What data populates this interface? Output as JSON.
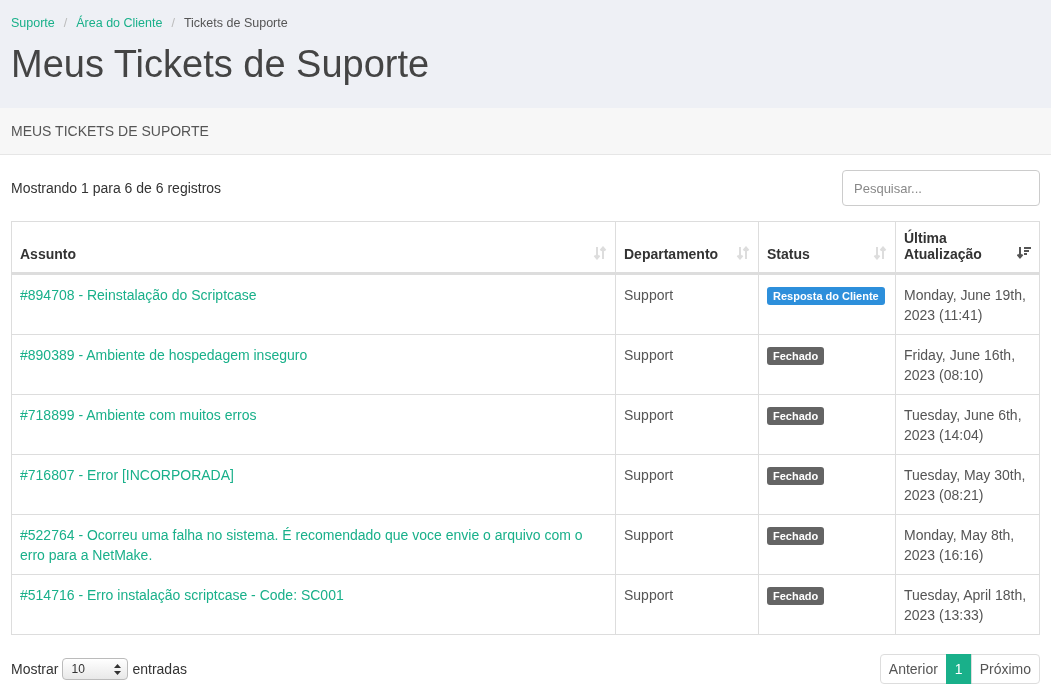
{
  "breadcrumb": [
    {
      "label": "Suporte",
      "current": false
    },
    {
      "separator": "/",
      "label": "Área do Cliente",
      "current": false
    },
    {
      "separator": "/",
      "label": "Tickets de Suporte",
      "current": true
    }
  ],
  "page_title": "Meus Tickets de Suporte",
  "panel_title": "MEUS TICKETS DE SUPORTE",
  "info": "Mostrando 1 para 6 de 6 registros",
  "search": {
    "placeholder": "Pesquisar..."
  },
  "columns": [
    {
      "label": "Assunto",
      "sorted": false
    },
    {
      "label": "Departamento",
      "sorted": false
    },
    {
      "label": "Status",
      "sorted": false
    },
    {
      "label": "Última Atualização",
      "sorted": true
    }
  ],
  "rows": [
    {
      "subject": "#894708 - Reinstalação do Scriptcase",
      "department": "Support",
      "status": "Resposta do Cliente",
      "color": "#2d8fdb",
      "updated": "Monday, June 19th, 2023 (11:41)"
    },
    {
      "subject": "#890389 - Ambiente de hospedagem inseguro",
      "department": "Support",
      "status": "Fechado",
      "color": "#646464",
      "updated": "Friday, June 16th, 2023 (08:10)"
    },
    {
      "subject": "#718899 - Ambiente com muitos erros",
      "department": "Support",
      "status": "Fechado",
      "color": "#646464",
      "updated": "Tuesday, June 6th, 2023 (14:04)"
    },
    {
      "subject": "#716807 - Error [INCORPORADA]",
      "department": "Support",
      "status": "Fechado",
      "color": "#646464",
      "updated": "Tuesday, May 30th, 2023 (08:21)"
    },
    {
      "subject": "#522764 - Ocorreu uma falha no sistema. É recomendado que voce envie o arquivo com o erro para a NetMake.",
      "department": "Support",
      "status": "Fechado",
      "color": "#646464",
      "updated": "Monday, May 8th, 2023 (16:16)"
    },
    {
      "subject": "#514716 - Erro instalação scriptcase - Code: SC001",
      "department": "Support",
      "status": "Fechado",
      "color": "#646464",
      "updated": "Tuesday, April 18th, 2023 (13:33)"
    }
  ],
  "length": {
    "before": "Mostrar",
    "value": "10",
    "after": "entradas"
  },
  "pagination": [
    {
      "label": "Anterior",
      "selected": false
    },
    {
      "label": "1",
      "selected": true
    },
    {
      "label": "Próximo",
      "selected": false
    }
  ]
}
